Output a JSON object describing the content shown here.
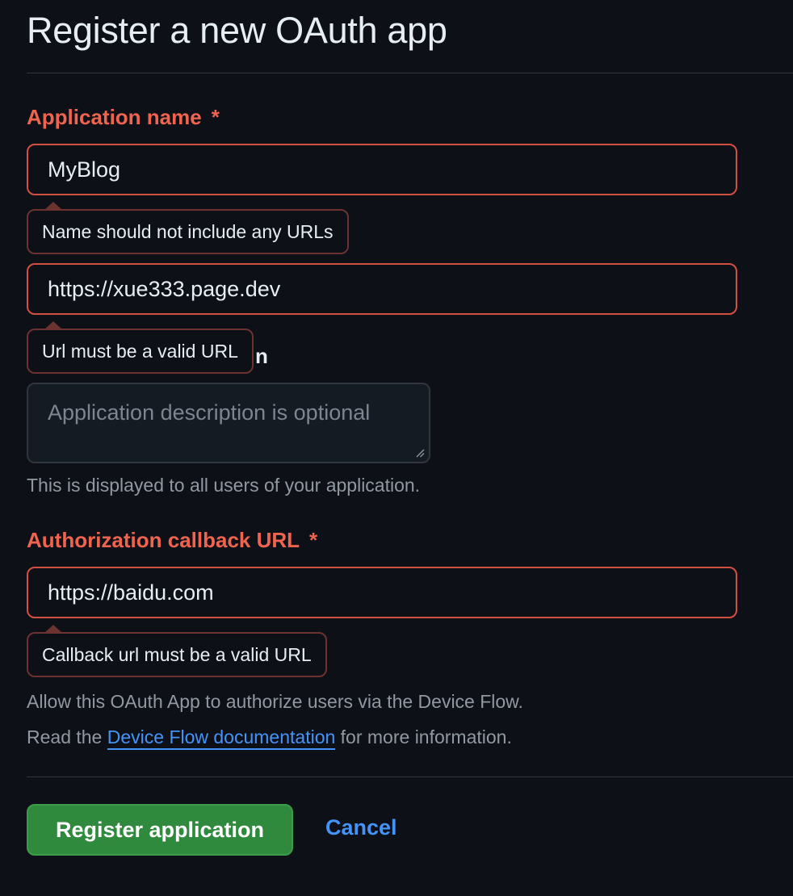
{
  "page": {
    "title": "Register a new OAuth app"
  },
  "form": {
    "app_name": {
      "label": "Application name",
      "required_mark": "*",
      "value": "MyBlog",
      "error": "Name should not include any URLs"
    },
    "homepage_url": {
      "value": "https://xue333.page.dev",
      "error": "Url must be a valid URL"
    },
    "description": {
      "label_partial": "n",
      "placeholder": "Application description is optional",
      "help": "This is displayed to all users of your application."
    },
    "callback_url": {
      "label": "Authorization callback URL",
      "required_mark": "*",
      "value": "https://baidu.com",
      "error": "Callback url must be a valid URL"
    },
    "device_flow": {
      "text": "Allow this OAuth App to authorize users via the Device Flow.",
      "read_prefix": "Read the",
      "link_label": "Device Flow documentation",
      "read_suffix": "for more information."
    }
  },
  "actions": {
    "register_label": "Register application",
    "cancel_label": "Cancel"
  },
  "colors": {
    "background": "#0d1117",
    "error": "#f0644f",
    "link": "#4493f8",
    "primary_button": "#2f8a3d"
  }
}
